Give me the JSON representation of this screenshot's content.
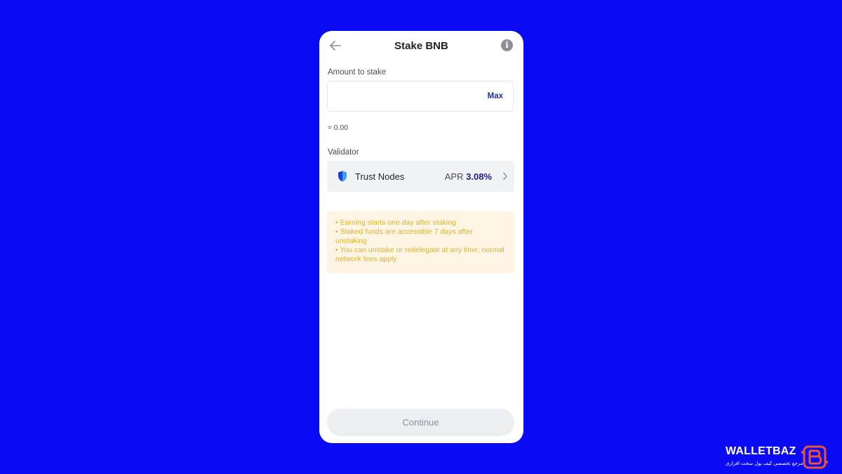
{
  "header": {
    "title": "Stake BNB"
  },
  "amount": {
    "label": "Amount to stake",
    "value": "",
    "placeholder": "",
    "max_label": "Max",
    "approx": "≈ 0.00"
  },
  "validator": {
    "label": "Validator",
    "name": "Trust Nodes",
    "apr_label": "APR",
    "apr_value": "3.08%"
  },
  "notice": {
    "lines": [
      "• Earning starts one day after staking",
      "• Staked funds are accessible 7 days after unstaking",
      "• You can unstake or redelegate at any time; normal network fees apply"
    ]
  },
  "actions": {
    "continue_label": "Continue"
  },
  "watermark": {
    "name": "WALLETBAZ",
    "tagline": "مرجع تخصصی کیف پول سخت افزاری"
  },
  "colors": {
    "background": "#0a0af5",
    "accent": "#1f2fa8",
    "notice_text": "#d9b52a",
    "notice_bg": "#fdf4e3"
  },
  "icons": {
    "back": "arrow-left-icon",
    "info": "info-icon",
    "validator": "shield-icon",
    "chevron": "chevron-right-icon"
  }
}
